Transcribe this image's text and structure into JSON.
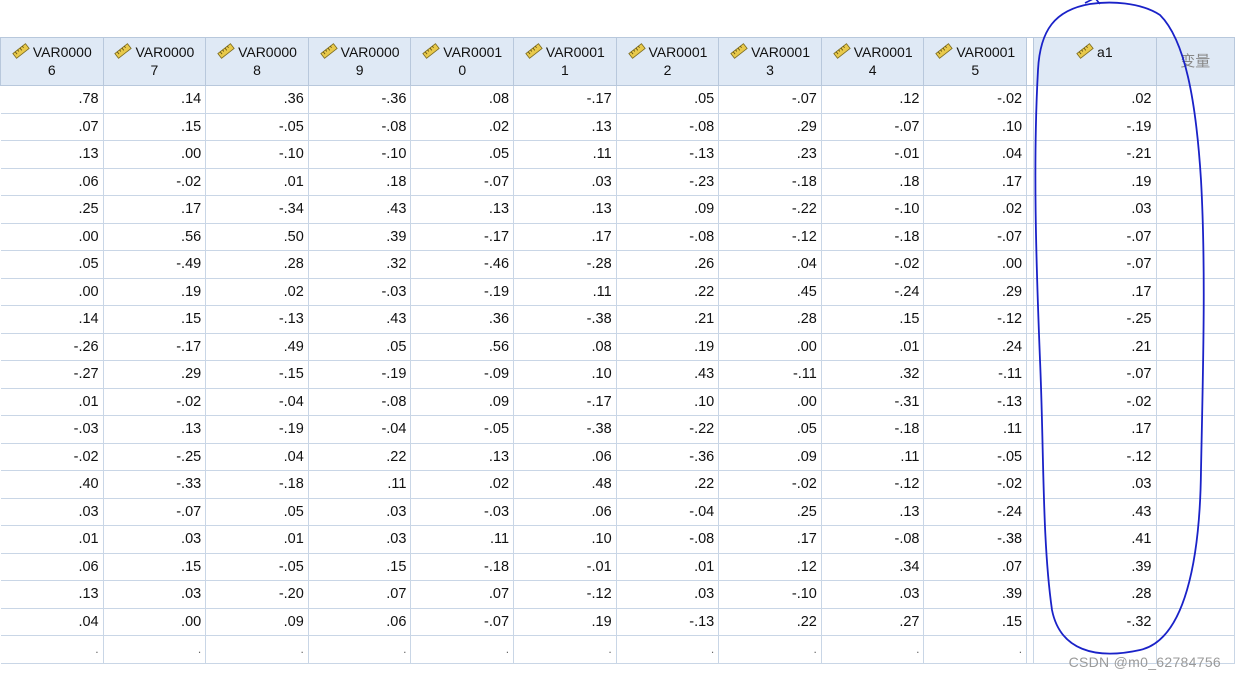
{
  "columns": [
    {
      "l1": "VAR0000",
      "l2": "6"
    },
    {
      "l1": "VAR0000",
      "l2": "7"
    },
    {
      "l1": "VAR0000",
      "l2": "8"
    },
    {
      "l1": "VAR0000",
      "l2": "9"
    },
    {
      "l1": "VAR0001",
      "l2": "0"
    },
    {
      "l1": "VAR0001",
      "l2": "1"
    },
    {
      "l1": "VAR0001",
      "l2": "2"
    },
    {
      "l1": "VAR0001",
      "l2": "3"
    },
    {
      "l1": "VAR0001",
      "l2": "4"
    },
    {
      "l1": "VAR0001",
      "l2": "5"
    }
  ],
  "a1_header": "a1",
  "blank_header": "变量",
  "rows": [
    [
      ".78",
      ".14",
      ".36",
      "-.36",
      ".08",
      "-.17",
      ".05",
      "-.07",
      ".12",
      "-.02",
      ".02"
    ],
    [
      ".07",
      ".15",
      "-.05",
      "-.08",
      ".02",
      ".13",
      "-.08",
      ".29",
      "-.07",
      ".10",
      "-.19"
    ],
    [
      ".13",
      ".00",
      "-.10",
      "-.10",
      ".05",
      ".11",
      "-.13",
      ".23",
      "-.01",
      ".04",
      "-.21"
    ],
    [
      ".06",
      "-.02",
      ".01",
      ".18",
      "-.07",
      ".03",
      "-.23",
      "-.18",
      ".18",
      ".17",
      ".19"
    ],
    [
      ".25",
      ".17",
      "-.34",
      ".43",
      ".13",
      ".13",
      ".09",
      "-.22",
      "-.10",
      ".02",
      ".03"
    ],
    [
      ".00",
      ".56",
      ".50",
      ".39",
      "-.17",
      ".17",
      "-.08",
      "-.12",
      "-.18",
      "-.07",
      "-.07"
    ],
    [
      ".05",
      "-.49",
      ".28",
      ".32",
      "-.46",
      "-.28",
      ".26",
      ".04",
      "-.02",
      ".00",
      "-.07"
    ],
    [
      ".00",
      ".19",
      ".02",
      "-.03",
      "-.19",
      ".11",
      ".22",
      ".45",
      "-.24",
      ".29",
      ".17"
    ],
    [
      ".14",
      ".15",
      "-.13",
      ".43",
      ".36",
      "-.38",
      ".21",
      ".28",
      ".15",
      "-.12",
      "-.25"
    ],
    [
      "-.26",
      "-.17",
      ".49",
      ".05",
      ".56",
      ".08",
      ".19",
      ".00",
      ".01",
      ".24",
      ".21"
    ],
    [
      "-.27",
      ".29",
      "-.15",
      "-.19",
      "-.09",
      ".10",
      ".43",
      "-.11",
      ".32",
      "-.11",
      "-.07"
    ],
    [
      ".01",
      "-.02",
      "-.04",
      "-.08",
      ".09",
      "-.17",
      ".10",
      ".00",
      "-.31",
      "-.13",
      "-.02"
    ],
    [
      "-.03",
      ".13",
      "-.19",
      "-.04",
      "-.05",
      "-.38",
      "-.22",
      ".05",
      "-.18",
      ".11",
      ".17"
    ],
    [
      "-.02",
      "-.25",
      ".04",
      ".22",
      ".13",
      ".06",
      "-.36",
      ".09",
      ".11",
      "-.05",
      "-.12"
    ],
    [
      ".40",
      "-.33",
      "-.18",
      ".11",
      ".02",
      ".48",
      ".22",
      "-.02",
      "-.12",
      "-.02",
      ".03"
    ],
    [
      ".03",
      "-.07",
      ".05",
      ".03",
      "-.03",
      ".06",
      "-.04",
      ".25",
      ".13",
      "-.24",
      ".43"
    ],
    [
      ".01",
      ".03",
      ".01",
      ".03",
      ".11",
      ".10",
      "-.08",
      ".17",
      "-.08",
      "-.38",
      ".41"
    ],
    [
      ".06",
      ".15",
      "-.05",
      ".15",
      "-.18",
      "-.01",
      ".01",
      ".12",
      ".34",
      ".07",
      ".39"
    ],
    [
      ".13",
      ".03",
      "-.20",
      ".07",
      ".07",
      "-.12",
      ".03",
      "-.10",
      ".03",
      ".39",
      ".28"
    ],
    [
      ".04",
      ".00",
      ".09",
      ".06",
      "-.07",
      ".19",
      "-.13",
      ".22",
      ".27",
      ".15",
      "-.32"
    ]
  ],
  "empty_row_marker": ".",
  "watermark": "CSDN @m0_62784756",
  "icon": "ruler-scale-icon",
  "colors": {
    "header_bg": "#dfe9f5",
    "grid_line": "#c9d6e6",
    "annotation": "#1a22c8"
  }
}
